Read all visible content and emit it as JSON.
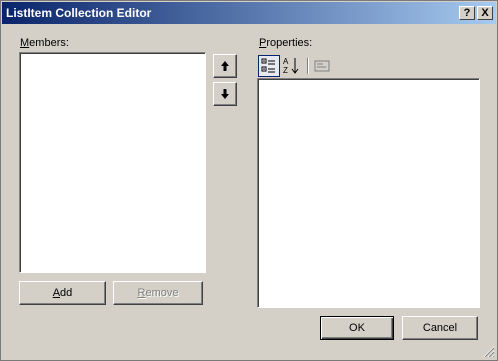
{
  "window": {
    "title": "ListItem Collection Editor"
  },
  "titlebar_buttons": {
    "help": "?",
    "close": "X"
  },
  "members": {
    "label": "Members:",
    "items": []
  },
  "properties": {
    "label": "Properties:"
  },
  "toolbar": {
    "categorized_icon": "categorized-icon",
    "alphabetical_icon": "alphabetical-icon",
    "property_pages_icon": "property-pages-icon"
  },
  "buttons": {
    "add": "Add",
    "remove": "Remove",
    "ok": "OK",
    "cancel": "Cancel"
  },
  "arrows": {
    "up": "up-arrow-icon",
    "down": "down-arrow-icon"
  }
}
